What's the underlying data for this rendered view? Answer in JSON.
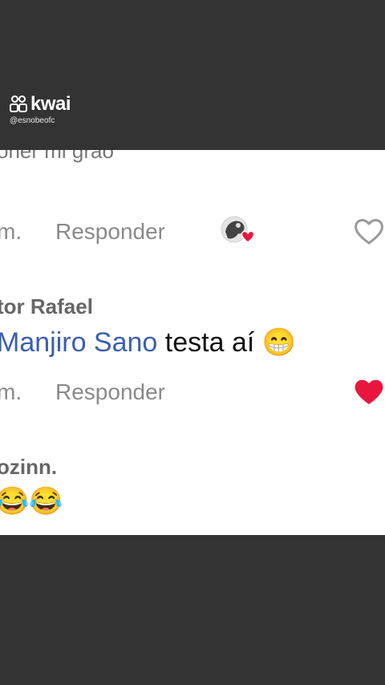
{
  "watermark": {
    "brand": "kwai",
    "handle": "@esnobeofc"
  },
  "comments": [
    {
      "cut_text": "oner mi grao",
      "time": "m.",
      "reply_label": "Responder"
    },
    {
      "author": "tor Rafael",
      "mention": "Manjiro Sano",
      "text": "testa aí",
      "emoji": "😁",
      "time": "m.",
      "reply_label": "Responder"
    },
    {
      "author": "ozinn.",
      "emojis": "😂😂"
    }
  ],
  "colors": {
    "mention": "#3a5fb0",
    "heart_filled": "#e8163f",
    "heart_outline": "#9a9a9a",
    "background": "#333333"
  },
  "icons": [
    "kwai-logo-icon",
    "heart-outline-icon",
    "heart-filled-icon",
    "avatar-with-heart-icon"
  ]
}
